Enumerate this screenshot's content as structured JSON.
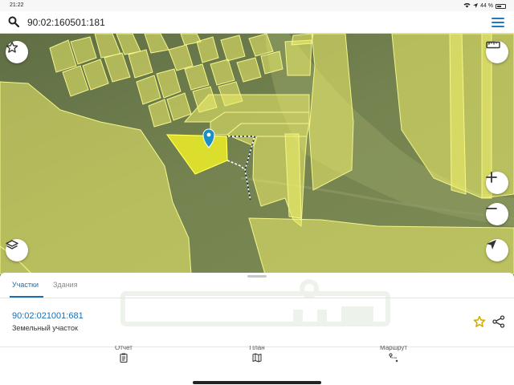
{
  "status_bar": {
    "time": "21:22",
    "battery_percent": "44 %"
  },
  "search": {
    "query": "90:02:160501:181"
  },
  "sheet": {
    "tabs": [
      {
        "label": "Участки",
        "active": true
      },
      {
        "label": "Здания",
        "active": false
      }
    ],
    "parcel": {
      "id": "90:02:021001:681",
      "type": "Земельный участок"
    }
  },
  "bottom_nav": [
    {
      "label": "Отчет",
      "icon": "clipboard-icon"
    },
    {
      "label": "План",
      "icon": "map-icon"
    },
    {
      "label": "Маршрут",
      "icon": "route-icon"
    }
  ],
  "colors": {
    "accent": "#1a6fb0",
    "parcel_fill": "#f0f06a",
    "selected_parcel": "#e8e82a",
    "map_ground": "#6f7e4c",
    "favorite_star": "#d4b000"
  }
}
